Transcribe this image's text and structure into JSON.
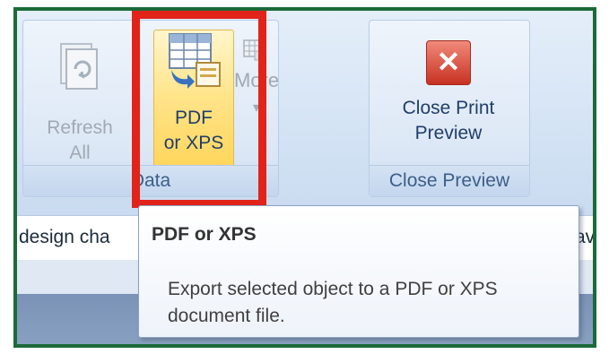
{
  "ribbon": {
    "data_group": {
      "label": "Data",
      "refresh_label": "Refresh\nAll",
      "pdf_label": "PDF\nor XPS",
      "more_label": "More",
      "more_caret": "▾"
    },
    "close_group": {
      "label": "Close Preview",
      "button_label": "Close Print\nPreview",
      "icon_glyph": "✕"
    }
  },
  "content_bar": {
    "left_text": "design cha",
    "right_text": "ave"
  },
  "tooltip": {
    "title": "PDF or XPS",
    "description": "Export selected object to a PDF or XPS document file."
  },
  "colors": {
    "highlight": "#e2231a",
    "frame": "#1b6a38",
    "pdf_button_bg": "#ffd456",
    "close_icon": "#c83122"
  }
}
